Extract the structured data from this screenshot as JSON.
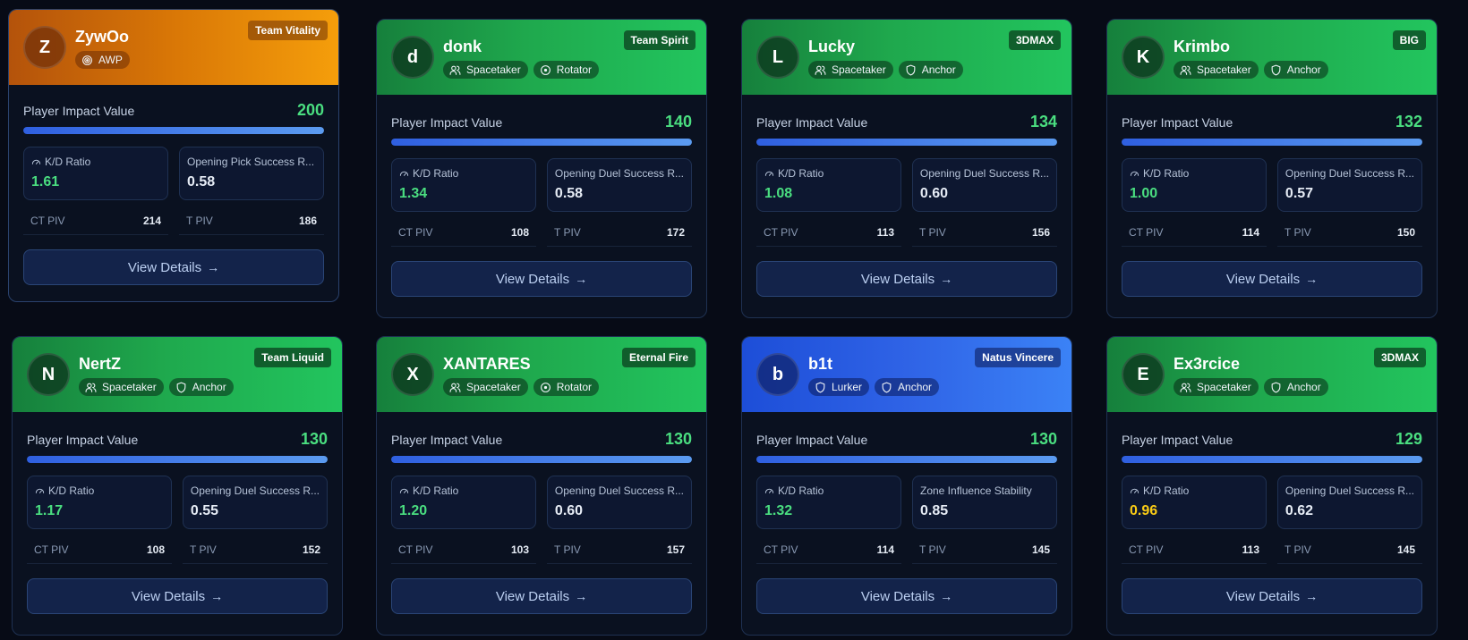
{
  "piv_label": "Player Impact Value",
  "view_details_label": "View Details",
  "view_details_arrow": "→",
  "side_labels": {
    "ct": "CT PIV",
    "t": "T PIV"
  },
  "colors": {
    "accent_green": "#4ade80",
    "accent_yellow": "#facc15",
    "header_green": "#22c55e",
    "header_blue": "#3b82f6",
    "header_orange": "#f59e0b"
  },
  "players": [
    {
      "initial": "Z",
      "name": "ZywOo",
      "team": "Team Vitality",
      "theme": "orange",
      "roles": [
        {
          "label": "AWP",
          "icon": "target-icon"
        }
      ],
      "piv": "200",
      "piv_fraction": 1.0,
      "stats": [
        {
          "label": "K/D Ratio",
          "value": "1.61",
          "tone": "good",
          "icon": "gauge-icon"
        },
        {
          "label": "Opening Pick Success R...",
          "value": "0.58",
          "tone": "plain"
        }
      ],
      "ct_piv": "214",
      "t_piv": "186"
    },
    {
      "initial": "d",
      "name": "donk",
      "team": "Team Spirit",
      "theme": "green",
      "roles": [
        {
          "label": "Spacetaker",
          "icon": "users-icon"
        },
        {
          "label": "Rotator",
          "icon": "rotate-icon"
        }
      ],
      "piv": "140",
      "piv_fraction": 1.0,
      "stats": [
        {
          "label": "K/D Ratio",
          "value": "1.34",
          "tone": "good",
          "icon": "gauge-icon"
        },
        {
          "label": "Opening Duel Success R...",
          "value": "0.58",
          "tone": "plain"
        }
      ],
      "ct_piv": "108",
      "t_piv": "172"
    },
    {
      "initial": "L",
      "name": "Lucky",
      "team": "3DMAX",
      "theme": "green",
      "roles": [
        {
          "label": "Spacetaker",
          "icon": "users-icon"
        },
        {
          "label": "Anchor",
          "icon": "shield-icon"
        }
      ],
      "piv": "134",
      "piv_fraction": 1.0,
      "stats": [
        {
          "label": "K/D Ratio",
          "value": "1.08",
          "tone": "good",
          "icon": "gauge-icon"
        },
        {
          "label": "Opening Duel Success R...",
          "value": "0.60",
          "tone": "plain"
        }
      ],
      "ct_piv": "113",
      "t_piv": "156"
    },
    {
      "initial": "K",
      "name": "Krimbo",
      "team": "BIG",
      "theme": "green",
      "roles": [
        {
          "label": "Spacetaker",
          "icon": "users-icon"
        },
        {
          "label": "Anchor",
          "icon": "shield-icon"
        }
      ],
      "piv": "132",
      "piv_fraction": 1.0,
      "stats": [
        {
          "label": "K/D Ratio",
          "value": "1.00",
          "tone": "good",
          "icon": "gauge-icon"
        },
        {
          "label": "Opening Duel Success R...",
          "value": "0.57",
          "tone": "plain"
        }
      ],
      "ct_piv": "114",
      "t_piv": "150"
    },
    {
      "initial": "N",
      "name": "NertZ",
      "team": "Team Liquid",
      "theme": "green",
      "roles": [
        {
          "label": "Spacetaker",
          "icon": "users-icon"
        },
        {
          "label": "Anchor",
          "icon": "shield-icon"
        }
      ],
      "piv": "130",
      "piv_fraction": 1.0,
      "stats": [
        {
          "label": "K/D Ratio",
          "value": "1.17",
          "tone": "good",
          "icon": "gauge-icon"
        },
        {
          "label": "Opening Duel Success R...",
          "value": "0.55",
          "tone": "plain"
        }
      ],
      "ct_piv": "108",
      "t_piv": "152"
    },
    {
      "initial": "X",
      "name": "XANTARES",
      "team": "Eternal Fire",
      "theme": "green",
      "roles": [
        {
          "label": "Spacetaker",
          "icon": "users-icon"
        },
        {
          "label": "Rotator",
          "icon": "rotate-icon"
        }
      ],
      "piv": "130",
      "piv_fraction": 1.0,
      "stats": [
        {
          "label": "K/D Ratio",
          "value": "1.20",
          "tone": "good",
          "icon": "gauge-icon"
        },
        {
          "label": "Opening Duel Success R...",
          "value": "0.60",
          "tone": "plain"
        }
      ],
      "ct_piv": "103",
      "t_piv": "157"
    },
    {
      "initial": "b",
      "name": "b1t",
      "team": "Natus Vincere",
      "theme": "blue",
      "roles": [
        {
          "label": "Lurker",
          "icon": "shield-icon"
        },
        {
          "label": "Anchor",
          "icon": "shield-icon"
        }
      ],
      "piv": "130",
      "piv_fraction": 1.0,
      "stats": [
        {
          "label": "K/D Ratio",
          "value": "1.32",
          "tone": "good",
          "icon": "gauge-icon"
        },
        {
          "label": "Zone Influence Stability",
          "value": "0.85",
          "tone": "plain"
        }
      ],
      "ct_piv": "114",
      "t_piv": "145"
    },
    {
      "initial": "E",
      "name": "Ex3rcice",
      "team": "3DMAX",
      "theme": "green",
      "roles": [
        {
          "label": "Spacetaker",
          "icon": "users-icon"
        },
        {
          "label": "Anchor",
          "icon": "shield-icon"
        }
      ],
      "piv": "129",
      "piv_fraction": 1.0,
      "stats": [
        {
          "label": "K/D Ratio",
          "value": "0.96",
          "tone": "warn",
          "icon": "gauge-icon"
        },
        {
          "label": "Opening Duel Success R...",
          "value": "0.62",
          "tone": "plain"
        }
      ],
      "ct_piv": "113",
      "t_piv": "145"
    }
  ]
}
